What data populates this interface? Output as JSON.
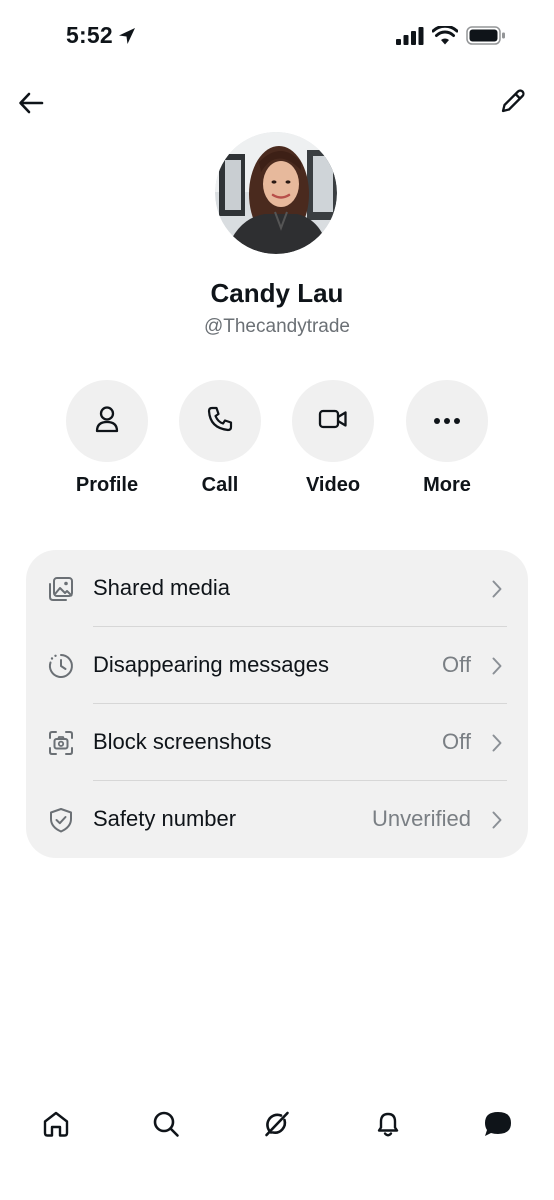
{
  "status_bar": {
    "time": "5:52",
    "location_icon": "location-arrow-icon",
    "signal_icon": "cellular-signal-icon",
    "wifi_icon": "wifi-icon",
    "battery_icon": "battery-icon"
  },
  "nav": {
    "back_icon": "arrow-left-icon",
    "edit_icon": "pencil-icon"
  },
  "profile": {
    "display_name": "Candy Lau",
    "handle": "@Thecandytrade"
  },
  "actions": [
    {
      "label": "Profile",
      "icon": "person-icon"
    },
    {
      "label": "Call",
      "icon": "phone-icon"
    },
    {
      "label": "Video",
      "icon": "video-camera-icon"
    },
    {
      "label": "More",
      "icon": "more-dots-icon"
    }
  ],
  "settings": [
    {
      "label": "Shared media",
      "value": "",
      "icon": "shared-media-icon"
    },
    {
      "label": "Disappearing messages",
      "value": "Off",
      "icon": "timer-clock-icon"
    },
    {
      "label": "Block screenshots",
      "value": "Off",
      "icon": "screenshot-camera-icon"
    },
    {
      "label": "Safety number",
      "value": "Unverified",
      "icon": "shield-check-icon"
    }
  ],
  "tab_bar": [
    {
      "icon": "home-icon"
    },
    {
      "icon": "search-icon"
    },
    {
      "icon": "grok-icon"
    },
    {
      "icon": "bell-icon"
    },
    {
      "icon": "messages-icon",
      "active": true
    }
  ],
  "colors": {
    "text_primary": "#0f1419",
    "text_secondary": "#6b7075",
    "card_background": "#f1f1f1",
    "button_background": "#f0f0f0"
  }
}
